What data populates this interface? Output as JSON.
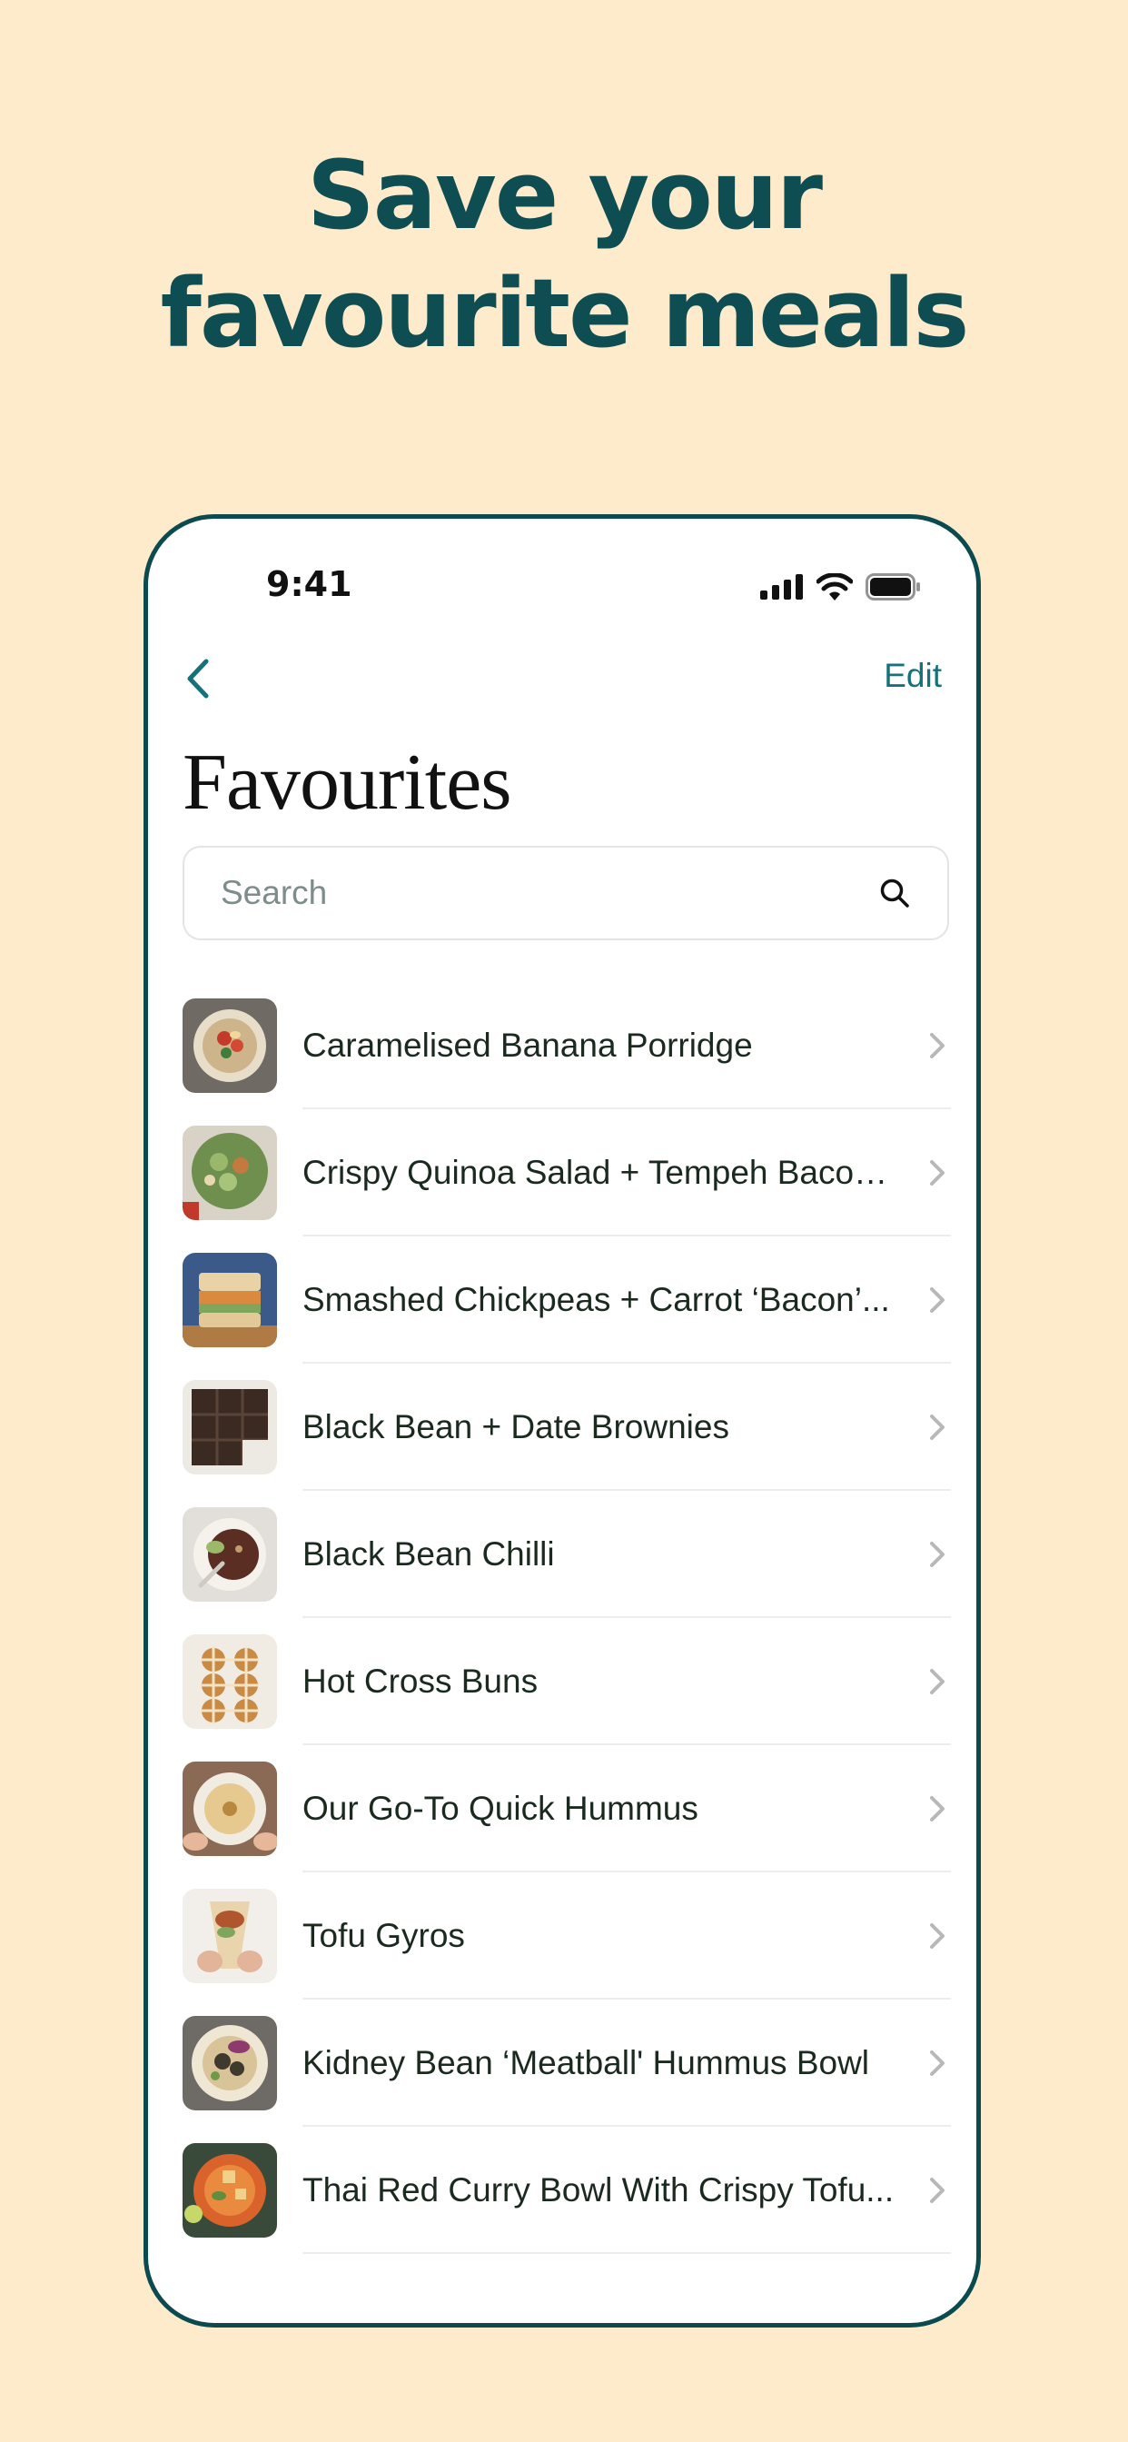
{
  "headline": {
    "line1": "Save your",
    "line2": "favourite meals"
  },
  "status_bar": {
    "time": "9:41",
    "icons": [
      "cellular-signal-icon",
      "wifi-icon",
      "battery-icon"
    ]
  },
  "nav": {
    "back_icon": "chevron-left-icon",
    "edit_label": "Edit"
  },
  "page": {
    "title": "Favourites"
  },
  "search": {
    "placeholder": "Search",
    "value": "",
    "icon": "search-icon"
  },
  "colors": {
    "background": "#FDEBCB",
    "accent": "#15727A",
    "headline": "#0E4D52",
    "frame": "#0B4A4E"
  },
  "favourites": [
    {
      "label": "Caramelised Banana Porridge",
      "thumb": "porridge-bowl"
    },
    {
      "label": "Crispy Quinoa Salad + Tempeh Bacon...",
      "thumb": "quinoa-salad"
    },
    {
      "label": "Smashed Chickpeas + Carrot ‘Bacon’...",
      "thumb": "chickpea-sandwich"
    },
    {
      "label": "Black Bean + Date Brownies",
      "thumb": "brownies-tray"
    },
    {
      "label": "Black Bean Chilli",
      "thumb": "chilli-bowl"
    },
    {
      "label": "Hot Cross Buns",
      "thumb": "hot-cross-buns"
    },
    {
      "label": "Our Go-To Quick Hummus",
      "thumb": "hummus-bowl"
    },
    {
      "label": "Tofu Gyros",
      "thumb": "tofu-gyros"
    },
    {
      "label": "Kidney Bean ‘Meatball' Hummus Bowl",
      "thumb": "meatball-hummus-bowl"
    },
    {
      "label": "Thai Red Curry Bowl With Crispy Tofu...",
      "thumb": "thai-curry-bowl"
    }
  ]
}
